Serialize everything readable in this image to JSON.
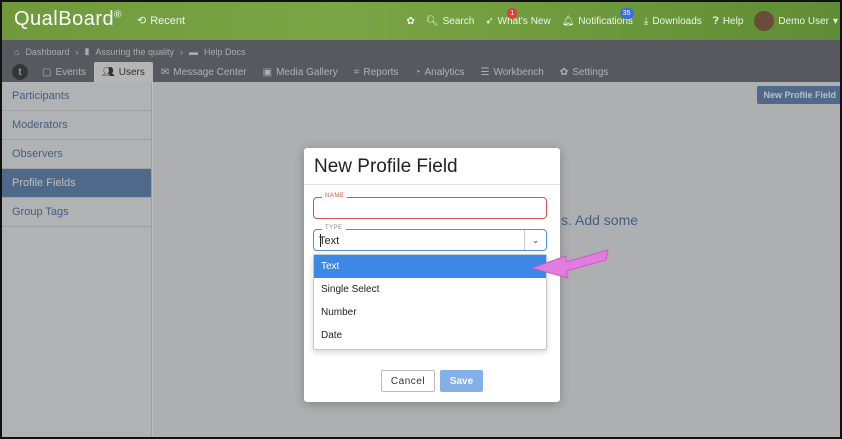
{
  "topbar": {
    "brand": "QualBoard",
    "brand_mark": "®",
    "recent": "Recent",
    "items": [
      {
        "label": "",
        "icon": "gear-icon"
      },
      {
        "label": "Search",
        "icon": "search-icon"
      },
      {
        "label": "What's New",
        "icon": "rocket-icon",
        "badge": "1"
      },
      {
        "label": "Notifications",
        "icon": "bell-icon",
        "badge": "35"
      },
      {
        "label": "Downloads",
        "icon": "download-icon"
      },
      {
        "label": "Help",
        "icon": "help-icon"
      },
      {
        "label": "Demo User",
        "icon": "avatar"
      }
    ]
  },
  "breadcrumb": {
    "items": [
      "Dashboard",
      "Assuring the quality",
      "Help Docs"
    ]
  },
  "tabs": [
    {
      "label": "Events",
      "icon": "calendar-icon"
    },
    {
      "label": "Users",
      "icon": "users-icon",
      "active": true
    },
    {
      "label": "Message Center",
      "icon": "envelope-icon"
    },
    {
      "label": "Media Gallery",
      "icon": "images-icon"
    },
    {
      "label": "Reports",
      "icon": "chart-icon"
    },
    {
      "label": "Analytics",
      "icon": "pie-chart-icon"
    },
    {
      "label": "Workbench",
      "icon": "list-icon"
    },
    {
      "label": "Settings",
      "icon": "gear-icon"
    }
  ],
  "sidebar": {
    "items": [
      {
        "label": "Participants"
      },
      {
        "label": "Moderators"
      },
      {
        "label": "Observers"
      },
      {
        "label": "Profile Fields",
        "active": true
      },
      {
        "label": "Group Tags"
      }
    ]
  },
  "main": {
    "new_profile_field_button": "New Profile Field",
    "empty_text_visible": "s. Add some"
  },
  "modal": {
    "title": "New Profile Field",
    "name_field": {
      "label": "NAME",
      "value": ""
    },
    "type_field": {
      "label": "TYPE",
      "value": "Text"
    },
    "options": [
      "Text",
      "Single Select",
      "Number",
      "Date"
    ],
    "selected_option": "Text",
    "cancel_label": "Cancel",
    "save_label": "Save"
  },
  "colors": {
    "topbar": "#7ba646",
    "nav": "#6b6f76",
    "accent": "#5f86b3",
    "dropdown_selected": "#3d87e6",
    "annotation_arrow": "#e27de0"
  }
}
